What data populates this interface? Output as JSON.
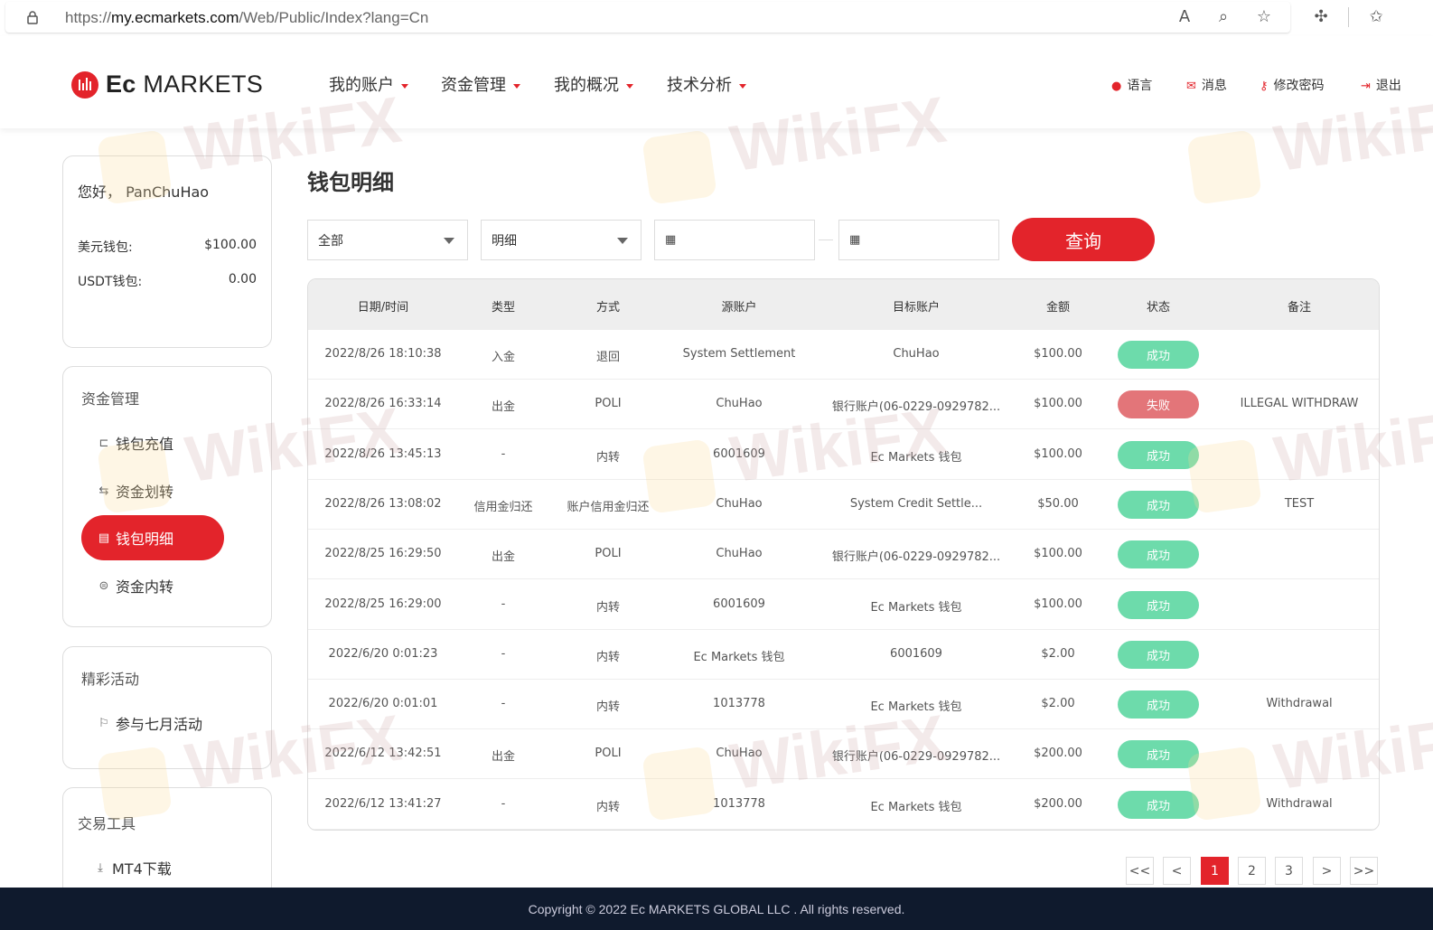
{
  "browser": {
    "url_prefix": "https://",
    "url_host": "my.ecmarkets.com",
    "url_path": "/Web/Public/Index?lang=Cn"
  },
  "header": {
    "logo_bold": "Ec",
    "logo_rest": " MARKETS",
    "nav": [
      "我的账户",
      "资金管理",
      "我的概况",
      "技术分析"
    ],
    "utils": [
      "语言",
      "消息",
      "修改密码",
      "退出"
    ]
  },
  "account_card": {
    "greeting": "您好，",
    "username": "PanChuHao",
    "usd_label": "美元钱包:",
    "usd_value": "$100.00",
    "usdt_label": "USDT钱包:",
    "usdt_value": "0.00"
  },
  "funds_card": {
    "title": "资金管理",
    "items": [
      "钱包充值",
      "资金划转",
      "钱包明细",
      "资金内转"
    ]
  },
  "events_card": {
    "title": "精彩活动",
    "items": [
      "参与七月活动"
    ]
  },
  "tools_card": {
    "title": "交易工具",
    "items": [
      "MT4下载"
    ]
  },
  "main": {
    "title": "钱包明细",
    "filter_type": "全部",
    "filter_detail": "明细",
    "query_label": "查询"
  },
  "table": {
    "headers": [
      "日期/时间",
      "类型",
      "方式",
      "源账户",
      "目标账户",
      "金额",
      "状态",
      "备注"
    ],
    "rows": [
      [
        "2022/8/26 18:10:38",
        "入金",
        "退回",
        "System Settlement",
        "ChuHao",
        "$100.00",
        "成功",
        ""
      ],
      [
        "2022/8/26 16:33:14",
        "出金",
        "POLI",
        "ChuHao",
        "银行账户(06-0229-0929782...",
        "$100.00",
        "失败",
        "ILLEGAL WITHDRAW"
      ],
      [
        "2022/8/26 13:45:13",
        "-",
        "内转",
        "6001609",
        "Ec Markets 钱包",
        "$100.00",
        "成功",
        ""
      ],
      [
        "2022/8/26 13:08:02",
        "信用金归还",
        "账户信用金归还",
        "ChuHao",
        "System Credit Settle...",
        "$50.00",
        "成功",
        "TEST"
      ],
      [
        "2022/8/25 16:29:50",
        "出金",
        "POLI",
        "ChuHao",
        "银行账户(06-0229-0929782...",
        "$100.00",
        "成功",
        ""
      ],
      [
        "2022/8/25 16:29:00",
        "-",
        "内转",
        "6001609",
        "Ec Markets 钱包",
        "$100.00",
        "成功",
        ""
      ],
      [
        "2022/6/20 0:01:23",
        "-",
        "内转",
        "Ec Markets 钱包",
        "6001609",
        "$2.00",
        "成功",
        ""
      ],
      [
        "2022/6/20 0:01:01",
        "-",
        "内转",
        "1013778",
        "Ec Markets 钱包",
        "$2.00",
        "成功",
        "Withdrawal"
      ],
      [
        "2022/6/12 13:42:51",
        "出金",
        "POLI",
        "ChuHao",
        "银行账户(06-0229-0929782...",
        "$200.00",
        "成功",
        ""
      ],
      [
        "2022/6/12 13:41:27",
        "-",
        "内转",
        "1013778",
        "Ec Markets 钱包",
        "$200.00",
        "成功",
        "Withdrawal"
      ]
    ]
  },
  "pagination": [
    "<<",
    "<",
    "1",
    "2",
    "3",
    ">",
    ">>"
  ],
  "footer": "Copyright © 2022 Ec MARKETS GLOBAL LLC . All rights reserved.",
  "watermark": "WikiFX",
  "colors": {
    "brand_red": "#e3242b",
    "success": "#6ddbab",
    "fail": "#e37579",
    "footer_bg": "#0f1a2d"
  }
}
